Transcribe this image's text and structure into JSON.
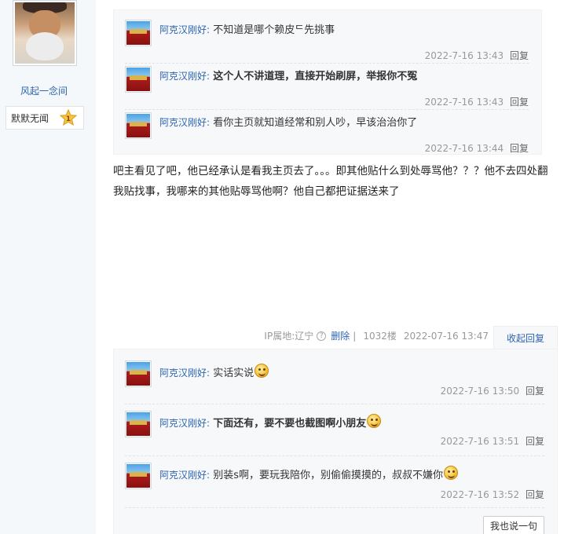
{
  "user": {
    "name": "风起一念间",
    "level_title": "默默无闻",
    "level_number": "1"
  },
  "replies_top": [
    {
      "author": "阿克汉刚好",
      "text": "不知道是哪个赖皮ᄃ先挑事",
      "bold": false,
      "time": "2022-7-16 13:43",
      "reply_label": "回复"
    },
    {
      "author": "阿克汉刚好",
      "text": "这个人不讲道理，直接开始刷屏，举报你不冤",
      "bold": true,
      "time": "2022-7-16 13:43",
      "reply_label": "回复"
    },
    {
      "author": "阿克汉刚好",
      "text": "看你主页就知道经常和别人吵，早该治治你了",
      "bold": false,
      "time": "2022-7-16 13:44",
      "reply_label": "回复"
    }
  ],
  "post": {
    "content": "吧主看见了吧，他已经承认是看我主页去了。。。即其他贴什么到处辱骂他？？？他不去四处翻我贴找事，我哪来的其他贴辱骂他啊？他自己都把证据送来了",
    "ip_location": "IP属地:辽宁",
    "delete_label": "删除",
    "floor": "1032楼",
    "time": "2022-07-16 13:47",
    "collapse_label": "收起回复"
  },
  "replies_bottom": [
    {
      "author": "阿克汉刚好",
      "text": "实话实说",
      "bold": false,
      "time": "2022-7-16 13:50",
      "reply_label": "回复",
      "emoji": "smile-emoji"
    },
    {
      "author": "阿克汉刚好",
      "text": "下面还有，要不要也截图啊小朋友",
      "bold": true,
      "time": "2022-7-16 13:51",
      "reply_label": "回复",
      "emoji": "smile-emoji"
    },
    {
      "author": "阿克汉刚好",
      "text": "别装s啊，要玩我陪你，别偷偷摸摸的，叔叔不嫌你",
      "bold": false,
      "time": "2022-7-16 13:52",
      "reply_label": "回复",
      "emoji": "smile-emoji"
    }
  ],
  "say_button_label": "我也说一句",
  "colors": {
    "link": "#2d64b3",
    "meta": "#999999",
    "panel": "#f7f8fa"
  }
}
